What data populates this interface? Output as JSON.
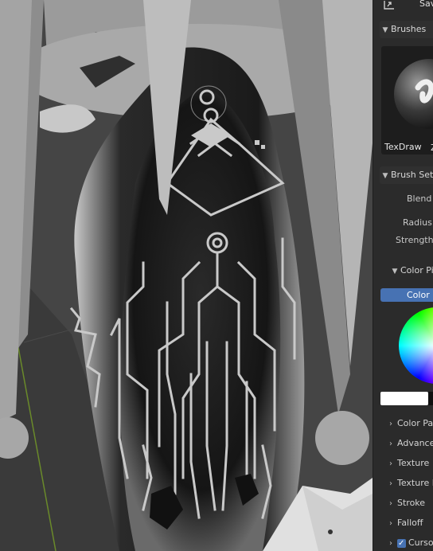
{
  "toolbar": {
    "save_label": "Save"
  },
  "brushes_panel": {
    "title": "Brushes",
    "brush_name": "TexDraw",
    "extra_label": "Z"
  },
  "brush_settings": {
    "title": "Brush Settings",
    "blend_label": "Blend",
    "radius_label": "Radius",
    "strength_label": "Strength"
  },
  "color_picker": {
    "title": "Color Picker",
    "color_tab": "Color",
    "primary_color": "#ffffff",
    "secondary_color": "#101010"
  },
  "sections": [
    {
      "label": "Color Palette"
    },
    {
      "label": "Advanced"
    },
    {
      "label": "Texture"
    },
    {
      "label": "Texture Mask"
    },
    {
      "label": "Stroke"
    },
    {
      "label": "Falloff"
    },
    {
      "label": "Cursor",
      "checked": true
    }
  ],
  "colors": {
    "accent": "#4772b3",
    "panel_bg": "#2b2b2b",
    "viewport_bg": "#3c3c3c"
  }
}
